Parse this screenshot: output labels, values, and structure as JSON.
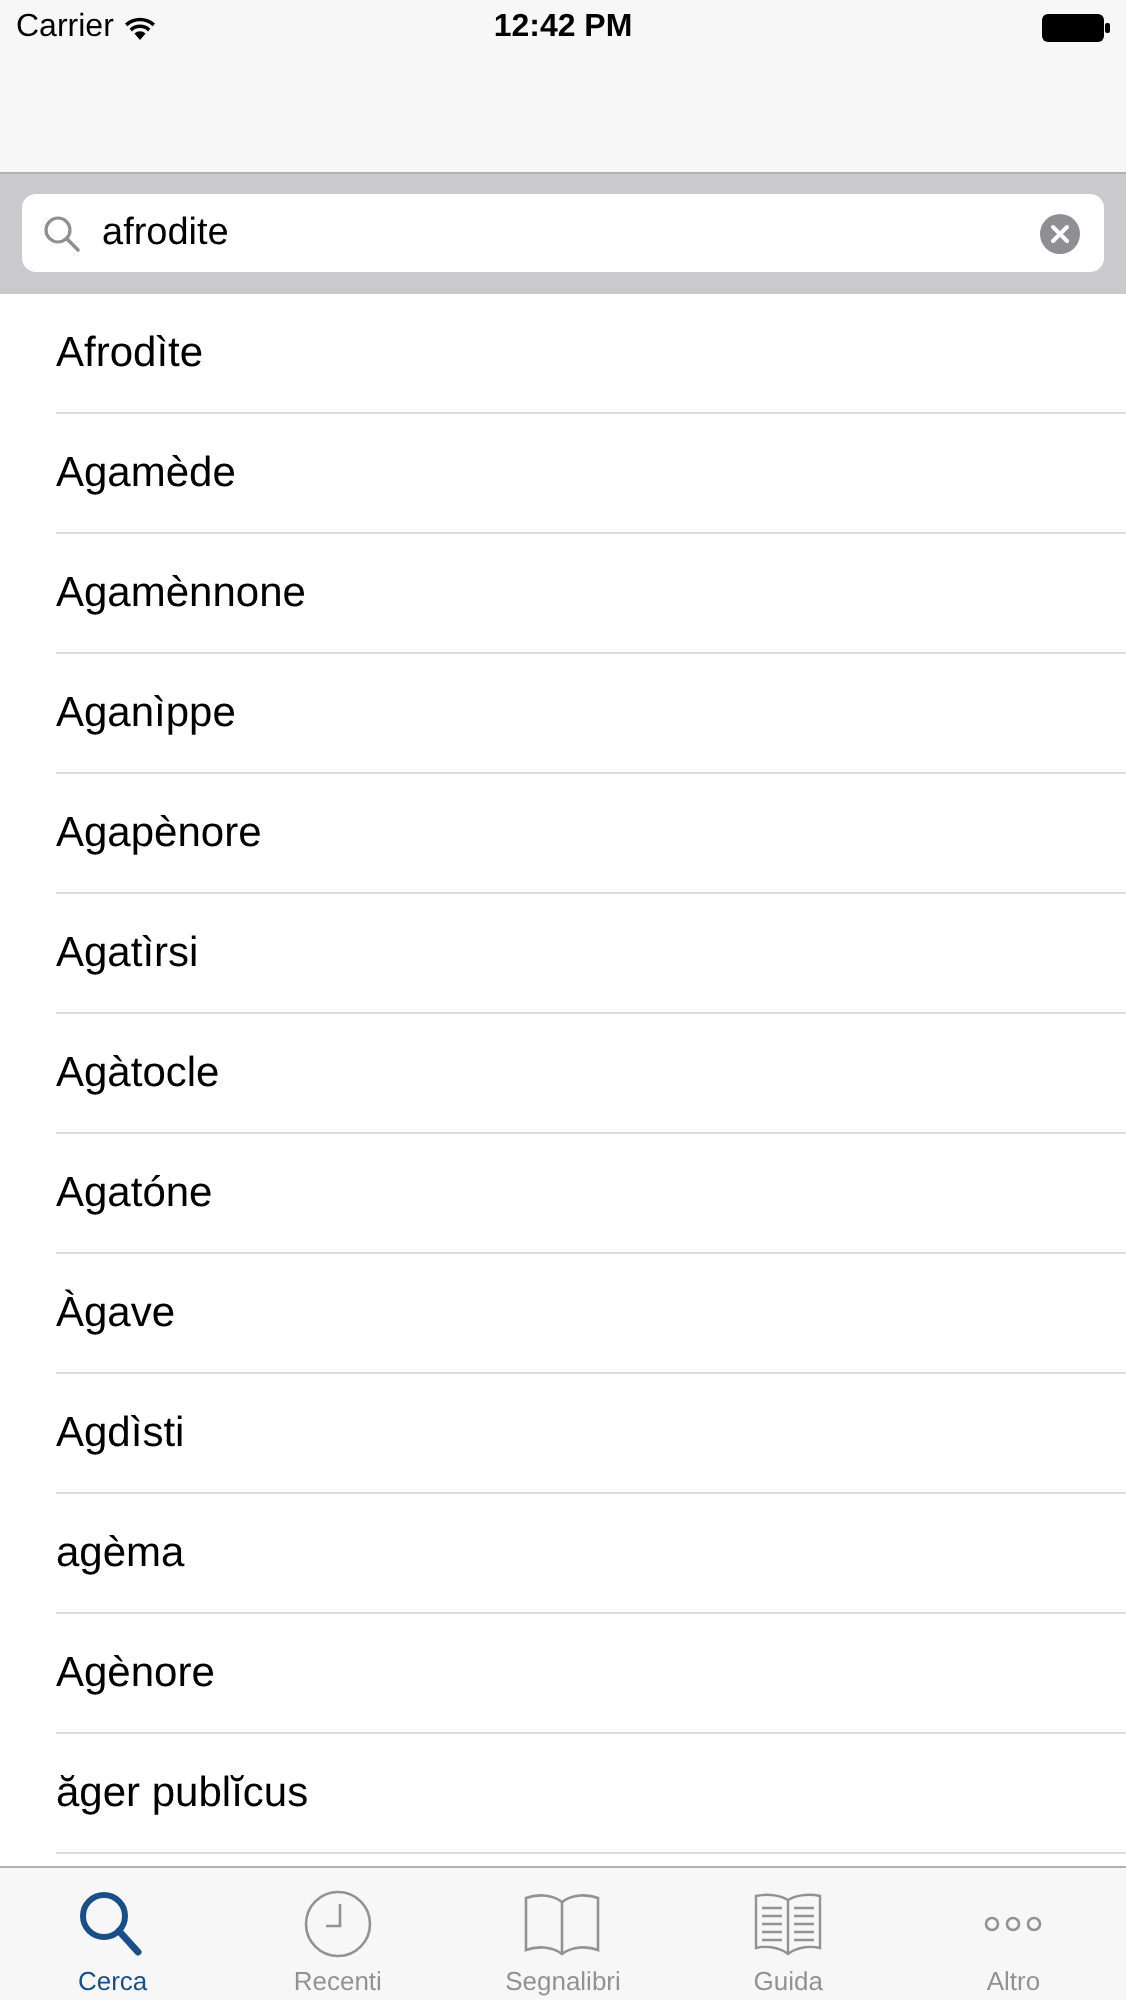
{
  "status_bar": {
    "carrier": "Carrier",
    "time": "12:42 PM"
  },
  "search": {
    "value": "afrodite"
  },
  "results": [
    "Afrodìte",
    "Agamède",
    "Agamènnone",
    "Aganìppe",
    "Agapènore",
    "Agatìrsi",
    "Agàtocle",
    "Agatóne",
    "Àgave",
    "Agdìsti",
    "agèma",
    "Agènore",
    "ăger publĭcus"
  ],
  "tabs": [
    {
      "label": "Cerca",
      "kind": "search",
      "selected": true
    },
    {
      "label": "Recenti",
      "kind": "clock",
      "selected": false
    },
    {
      "label": "Segnalibri",
      "kind": "book",
      "selected": false
    },
    {
      "label": "Guida",
      "kind": "guide",
      "selected": false
    },
    {
      "label": "Altro",
      "kind": "more",
      "selected": false
    }
  ]
}
